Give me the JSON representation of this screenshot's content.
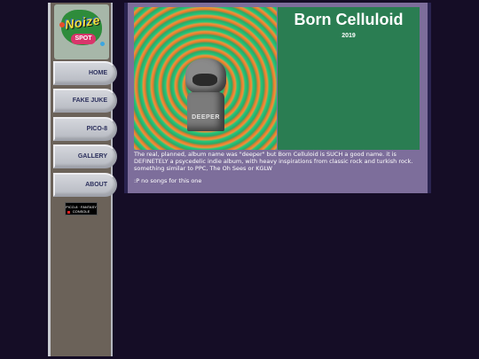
{
  "logo": {
    "word_top": "Noize",
    "word_bottom": "SPOT"
  },
  "nav": {
    "items": [
      {
        "label": "HOME"
      },
      {
        "label": "FAKE JUKE"
      },
      {
        "label": "PICO-8"
      },
      {
        "label": "GALLERY"
      },
      {
        "label": "ABOUT"
      }
    ]
  },
  "badge": {
    "text": "PICO-8 · FANTASY CONSOLE"
  },
  "album": {
    "title": "Born Celluloid",
    "year": "2019",
    "cover_text": "DEEPER",
    "description": "The real, planned, album name was \"deeper\" but Born Celluloid is SUCH a good name. it is DEFINETELY a psycedelic indie album, with heavy inspirations from classic rock and turkish rock. something similar to PPC, The Oh Sees or KGLW",
    "songs_note": ":P no songs for this one"
  },
  "colors": {
    "background": "#150d26",
    "sidebar": "#6b6259",
    "panel": "#7d6e9b",
    "title_box": "#2a7d52",
    "nav_text": "#2b2f5c"
  }
}
